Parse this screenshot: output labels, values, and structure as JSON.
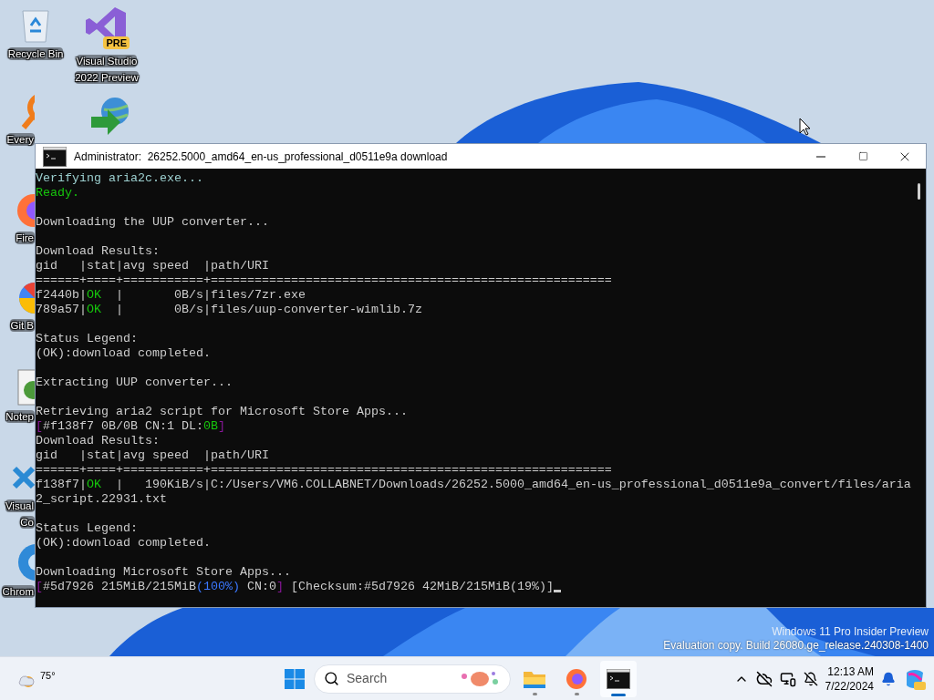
{
  "desktop": {
    "icons": [
      {
        "kind": "recycle",
        "label_lines": [
          "Recycle Bin"
        ]
      },
      {
        "kind": "vs",
        "label_lines": [
          "Visual Studio",
          "2022 Preview"
        ],
        "badge": "PRE"
      },
      {
        "kind": "search",
        "label_lines": [
          "Every"
        ]
      },
      {
        "kind": "download"
      },
      {
        "kind": "firefox",
        "label_lines": [
          "Fire"
        ]
      },
      {
        "kind": "git",
        "label_lines": [
          "Git B"
        ]
      },
      {
        "kind": "notepad",
        "label_lines": [
          "Notep"
        ]
      },
      {
        "kind": "vscode",
        "label_lines": [
          "Visual",
          "Co"
        ]
      },
      {
        "kind": "chrome",
        "label_lines": [
          "Chrom"
        ]
      }
    ],
    "watermark": [
      "Windows 11 Pro Insider Preview",
      "Evaluation copy. Build 26080.ge_release.240308-1400"
    ]
  },
  "window": {
    "title": "Administrator:  26252.5000_amd64_en-us_professional_d0511e9a download",
    "blocks": [
      {
        "lines": [
          [
            {
              "text": "Verifying aria2c.exe...",
              "color": "#9ccfcf"
            }
          ],
          [
            {
              "text": "Ready.",
              "color": "#16c60c"
            }
          ]
        ]
      },
      {
        "lines": [
          [
            {
              "text": "Downloading the UUP converter...",
              "color": "#cccccc"
            }
          ]
        ]
      },
      {
        "lines": [
          [
            {
              "text": "Download Results:",
              "color": "#cccccc"
            }
          ],
          [
            {
              "text": "gid   |stat|avg speed  |path/URI",
              "color": "#cccccc"
            }
          ],
          [
            {
              "text": "======+====+===========+=======================================================",
              "color": "#cccccc"
            }
          ],
          [
            {
              "text": "f2440b|",
              "color": "#cccccc"
            },
            {
              "text": "OK",
              "color": "#16c60c"
            },
            {
              "text": "  |       0B/s|files/7zr.exe",
              "color": "#cccccc"
            }
          ],
          [
            {
              "text": "789a57|",
              "color": "#cccccc"
            },
            {
              "text": "OK",
              "color": "#16c60c"
            },
            {
              "text": "  |       0B/s|files/uup-converter-wimlib.7z",
              "color": "#cccccc"
            }
          ]
        ]
      },
      {
        "lines": [
          [
            {
              "text": "Status Legend:",
              "color": "#cccccc"
            }
          ],
          [
            {
              "text": "(OK):download completed.",
              "color": "#cccccc"
            }
          ]
        ]
      },
      {
        "lines": [
          [
            {
              "text": "Extracting UUP converter...",
              "color": "#cccccc"
            }
          ]
        ]
      },
      {
        "lines": [
          [
            {
              "text": "Retrieving aria2 script for Microsoft Store Apps...",
              "color": "#cccccc"
            }
          ],
          [
            {
              "text": "[",
              "color": "#881798"
            },
            {
              "text": "#f138f7 0B/0B CN:1 DL:",
              "color": "#cccccc"
            },
            {
              "text": "0B",
              "color": "#16c60c"
            },
            {
              "text": "]",
              "color": "#881798"
            }
          ],
          [
            {
              "text": "Download Results:",
              "color": "#cccccc"
            }
          ],
          [
            {
              "text": "gid   |stat|avg speed  |path/URI",
              "color": "#cccccc"
            }
          ],
          [
            {
              "text": "======+====+===========+=======================================================",
              "color": "#cccccc"
            }
          ],
          [
            {
              "text": "f138f7|",
              "color": "#cccccc"
            },
            {
              "text": "OK",
              "color": "#16c60c"
            },
            {
              "text": "  |   190KiB/s|C:/Users/VM6.COLLABNET/Downloads/26252.5000_amd64_en-us_professional_d0511e9a_convert/files/aria",
              "color": "#cccccc"
            }
          ],
          [
            {
              "text": "2_script.22931.txt",
              "color": "#cccccc"
            }
          ]
        ]
      },
      {
        "lines": [
          [
            {
              "text": "Status Legend:",
              "color": "#cccccc"
            }
          ],
          [
            {
              "text": "(OK):download completed.",
              "color": "#cccccc"
            }
          ]
        ]
      },
      {
        "lines": [
          [
            {
              "text": "Downloading Microsoft Store Apps...",
              "color": "#cccccc"
            }
          ],
          [
            {
              "text": "[",
              "color": "#881798"
            },
            {
              "text": "#5d7926 215MiB/215MiB",
              "color": "#cccccc"
            },
            {
              "text": "(100%)",
              "color": "#3b78ff"
            },
            {
              "text": " CN:0",
              "color": "#cccccc"
            },
            {
              "text": "]",
              "color": "#881798"
            },
            {
              "text": " [Checksum:#5d7926 42MiB/215MiB(19%)]",
              "color": "#cccccc"
            }
          ]
        ]
      }
    ]
  },
  "taskbar": {
    "weather": "75°",
    "search": {
      "placeholder": "Search"
    },
    "apps": [
      {
        "kind": "explorer",
        "selected": false
      },
      {
        "kind": "firefox",
        "selected": false
      },
      {
        "kind": "terminal",
        "selected": true
      }
    ],
    "time": "12:13 AM",
    "date": "7/22/2024"
  }
}
